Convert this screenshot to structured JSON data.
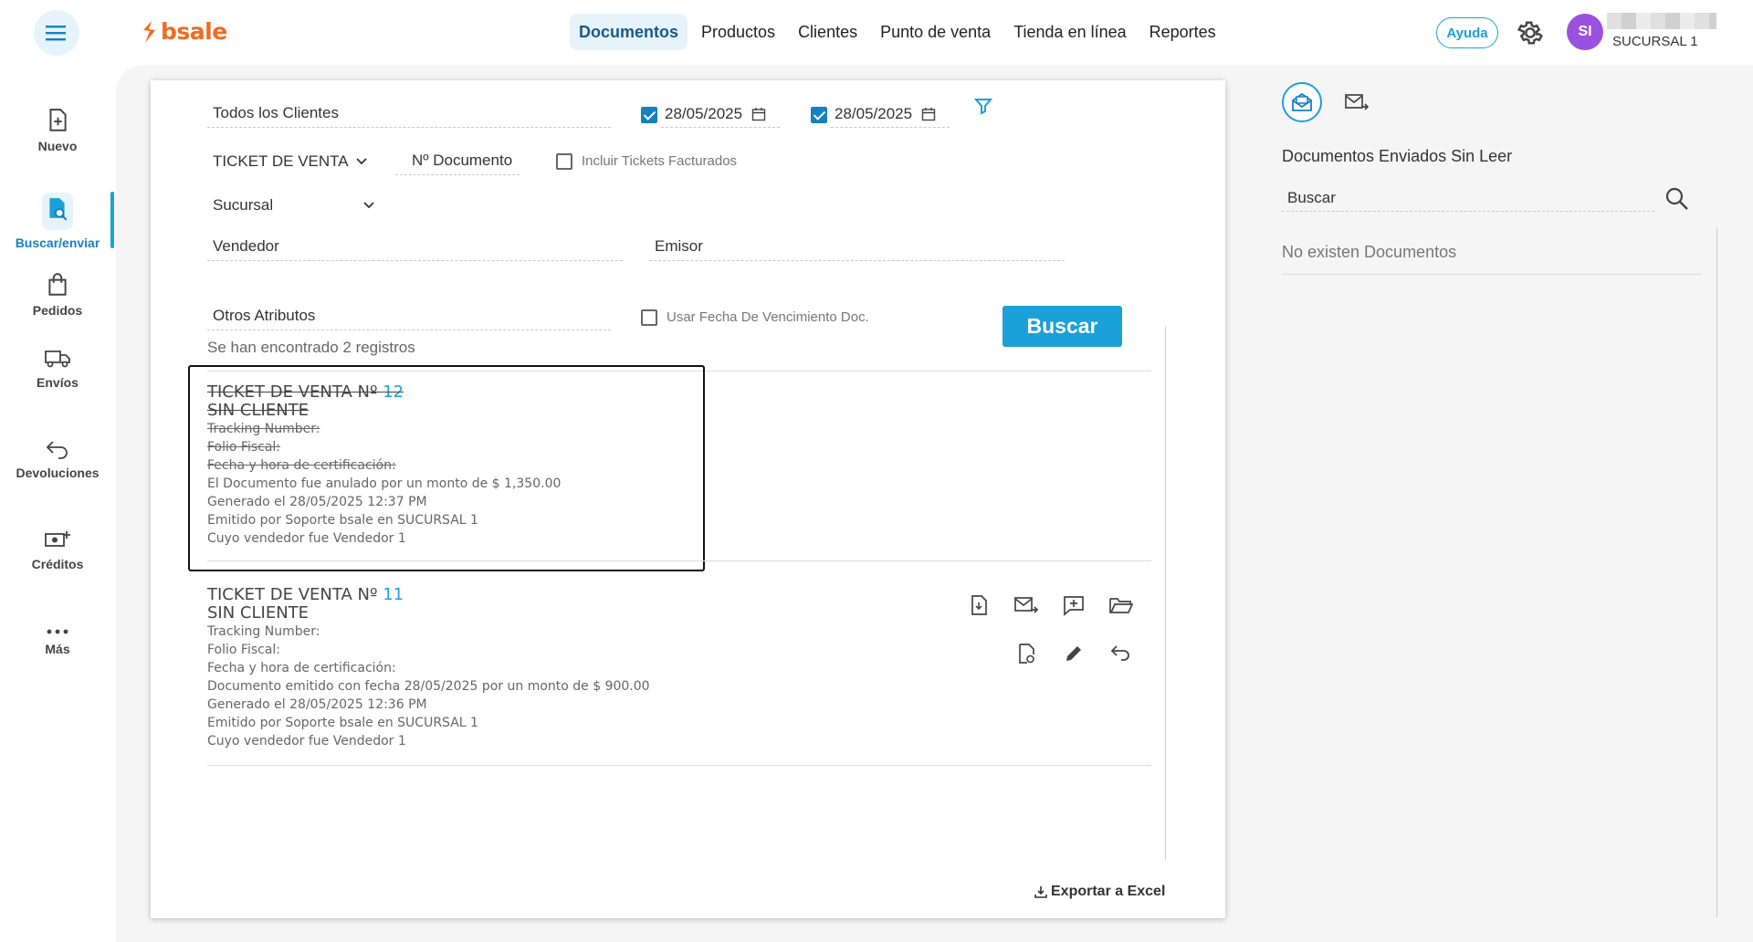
{
  "header": {
    "logo_text": "bsale",
    "nav": [
      "Documentos",
      "Productos",
      "Clientes",
      "Punto de venta",
      "Tienda en línea",
      "Reportes"
    ],
    "active_nav": "Documentos",
    "help_label": "Ayuda",
    "avatar_initials": "SI",
    "branch": "SUCURSAL 1"
  },
  "sidebar": {
    "items": [
      {
        "label": "Nuevo",
        "icon": "new-document-icon"
      },
      {
        "label": "Buscar/enviar",
        "icon": "search-document-icon"
      },
      {
        "label": "Pedidos",
        "icon": "shopping-bag-icon"
      },
      {
        "label": "Envíos",
        "icon": "truck-icon"
      },
      {
        "label": "Devoluciones",
        "icon": "return-icon"
      },
      {
        "label": "Créditos",
        "icon": "money-plus-icon"
      },
      {
        "label": "Más",
        "icon": "more-dots-icon"
      }
    ],
    "active": "Buscar/enviar"
  },
  "filters": {
    "client": "Todos los Clientes",
    "date_from": "28/05/2025",
    "date_to": "28/05/2025",
    "doc_type": "TICKET DE VENTA",
    "doc_number_placeholder": "Nº Documento",
    "include_invoiced_label": "Incluir Tickets Facturados",
    "branch": "Sucursal",
    "seller": "Vendedor",
    "issuer": "Emisor",
    "other_attributes": "Otros Atributos",
    "use_due_date_label": "Usar Fecha De Vencimiento Doc.",
    "search_button": "Buscar"
  },
  "results": {
    "count_text": "Se han encontrado 2 registros",
    "documents": [
      {
        "title": "TICKET DE VENTA Nº",
        "number": "12",
        "client": "SIN CLIENTE",
        "tracking": "Tracking Number:",
        "folio": "Folio Fiscal:",
        "certification": "Fecha y hora de certificación:",
        "status": "El Documento fue anulado por un monto de $ 1,350.00",
        "generated": "Generado el 28/05/2025 12:37 PM",
        "emitted": "Emitido por Soporte bsale en SUCURSAL 1",
        "seller": "Cuyo vendedor fue Vendedor 1",
        "voided": true
      },
      {
        "title": "TICKET DE VENTA Nº",
        "number": "11",
        "client": "SIN CLIENTE",
        "tracking": "Tracking Number:",
        "folio": "Folio Fiscal:",
        "certification": "Fecha y hora de certificación:",
        "status": "Documento emitido con fecha 28/05/2025 por un monto de $ 900.00",
        "generated": "Generado el 28/05/2025 12:36 PM",
        "emitted": "Emitido por Soporte bsale en SUCURSAL 1",
        "seller": "Cuyo vendedor fue Vendedor 1",
        "voided": false
      }
    ],
    "export_label": "Exportar a Excel"
  },
  "right_panel": {
    "title": "Documentos Enviados Sin Leer",
    "search_placeholder": "Buscar",
    "empty_text": "No existen Documentos"
  },
  "colors": {
    "brand_orange": "#f26a21",
    "accent_blue": "#1ba0d8",
    "avatar_purple": "#9b51e0"
  }
}
